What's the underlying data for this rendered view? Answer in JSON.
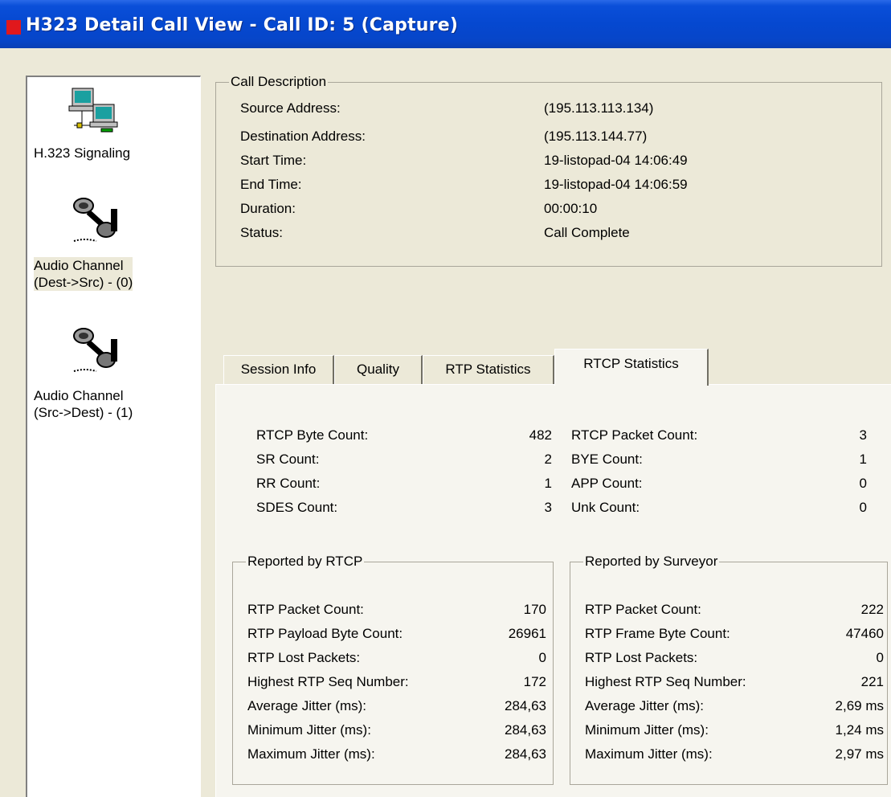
{
  "window": {
    "title": "H323 Detail Call View - Call ID: 5 (Capture)"
  },
  "sidebar": {
    "items": [
      {
        "label": "H.323 Signaling",
        "icon": "network-computers-icon"
      },
      {
        "label": "Audio Channel\n(Dest->Src) - (0)",
        "icon": "audio-channel-icon",
        "selected": true
      },
      {
        "label": "Audio Channel\n(Src->Dest) - (1)",
        "icon": "audio-channel-icon"
      }
    ]
  },
  "call_description": {
    "legend": "Call Description",
    "rows": [
      {
        "label": "Source Address:",
        "value": "(195.113.113.134)"
      },
      {
        "label": "Destination Address:",
        "value": "(195.113.144.77)"
      },
      {
        "label": "Start Time:",
        "value": "19-listopad-04  14:06:49"
      },
      {
        "label": "End Time:",
        "value": "19-listopad-04  14:06:59"
      },
      {
        "label": "Duration:",
        "value": "00:00:10"
      },
      {
        "label": "Status:",
        "value": "Call Complete"
      }
    ]
  },
  "tabs": [
    {
      "label": "Session Info"
    },
    {
      "label": "Quality"
    },
    {
      "label": "RTP Statistics"
    },
    {
      "label": "RTCP Statistics",
      "active": true
    }
  ],
  "rtcp_counts": {
    "left": [
      {
        "label": "RTCP Byte Count:",
        "value": "482"
      },
      {
        "label": "SR Count:",
        "value": "2"
      },
      {
        "label": "RR Count:",
        "value": "1"
      },
      {
        "label": "SDES Count:",
        "value": "3"
      }
    ],
    "right": [
      {
        "label": "RTCP Packet Count:",
        "value": "3"
      },
      {
        "label": "BYE Count:",
        "value": "1"
      },
      {
        "label": "APP Count:",
        "value": "0"
      },
      {
        "label": "Unk Count:",
        "value": "0"
      }
    ]
  },
  "reported_by_rtcp": {
    "legend": "Reported by RTCP",
    "rows": [
      {
        "label": "RTP Packet Count:",
        "value": "170"
      },
      {
        "label": "RTP Payload Byte Count:",
        "value": "26961"
      },
      {
        "label": "RTP Lost Packets:",
        "value": "0"
      },
      {
        "label": "Highest RTP Seq Number:",
        "value": "172"
      },
      {
        "label": "Average Jitter (ms):",
        "value": "284,63"
      },
      {
        "label": "Minimum Jitter (ms):",
        "value": "284,63"
      },
      {
        "label": "Maximum Jitter (ms):",
        "value": "284,63"
      }
    ]
  },
  "reported_by_surveyor": {
    "legend": "Reported by Surveyor",
    "rows": [
      {
        "label": "RTP Packet Count:",
        "value": "222"
      },
      {
        "label": "RTP Frame Byte Count:",
        "value": "47460"
      },
      {
        "label": "RTP Lost Packets:",
        "value": "0"
      },
      {
        "label": "Highest RTP Seq Number:",
        "value": "221"
      },
      {
        "label": "Average Jitter (ms):",
        "value": "2,69 ms"
      },
      {
        "label": "Minimum Jitter (ms):",
        "value": "1,24 ms"
      },
      {
        "label": "Maximum Jitter (ms):",
        "value": "2,97 ms"
      }
    ]
  },
  "colors": {
    "titlebar": "#0548d0",
    "dialog_bg": "#ece9d8",
    "panel_bg": "#f6f5ef",
    "close_square": "#e0181c"
  }
}
